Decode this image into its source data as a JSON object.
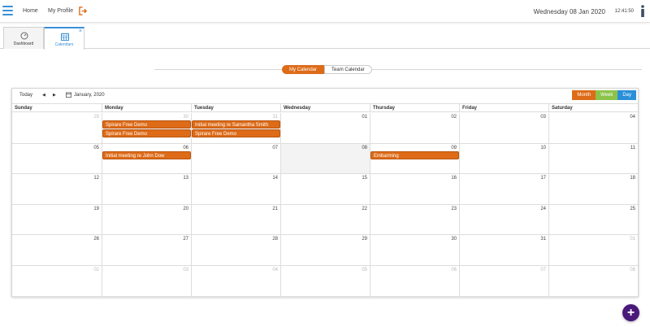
{
  "topbar": {
    "home": "Home",
    "profile": "My Profile",
    "date": "Wednesday 08 Jan 2020",
    "time": "12:41:50"
  },
  "tabs": [
    {
      "label": "Dashboard",
      "icon": "dashboard-icon"
    },
    {
      "label": "Calendars",
      "icon": "calendar-icon",
      "close": "×"
    }
  ],
  "switch": {
    "mine": "My Calendar",
    "team": "Team Calendar"
  },
  "calendar": {
    "today": "Today",
    "prev": "◀",
    "next": "▶",
    "title": "January, 2020",
    "views": [
      "Month",
      "Week",
      "Day"
    ],
    "day_names": [
      "Sunday",
      "Monday",
      "Tuesday",
      "Wednesday",
      "Thursday",
      "Friday",
      "Saturday"
    ],
    "weeks": [
      [
        {
          "n": "29",
          "o": true
        },
        {
          "n": "30",
          "o": true
        },
        {
          "n": "31",
          "o": true
        },
        {
          "n": "01"
        },
        {
          "n": "02"
        },
        {
          "n": "03"
        },
        {
          "n": "04"
        }
      ],
      [
        {
          "n": "05"
        },
        {
          "n": "06"
        },
        {
          "n": "07"
        },
        {
          "n": "08",
          "today": true
        },
        {
          "n": "09"
        },
        {
          "n": "10"
        },
        {
          "n": "11"
        }
      ],
      [
        {
          "n": "12"
        },
        {
          "n": "13"
        },
        {
          "n": "14"
        },
        {
          "n": "15"
        },
        {
          "n": "16"
        },
        {
          "n": "17"
        },
        {
          "n": "18"
        }
      ],
      [
        {
          "n": "19"
        },
        {
          "n": "20"
        },
        {
          "n": "21"
        },
        {
          "n": "22"
        },
        {
          "n": "23"
        },
        {
          "n": "24"
        },
        {
          "n": "25"
        }
      ],
      [
        {
          "n": "26"
        },
        {
          "n": "27"
        },
        {
          "n": "28"
        },
        {
          "n": "29"
        },
        {
          "n": "30"
        },
        {
          "n": "31"
        },
        {
          "n": "01",
          "o": true
        }
      ],
      [
        {
          "n": "02",
          "o": true
        },
        {
          "n": "03",
          "o": true
        },
        {
          "n": "04",
          "o": true
        },
        {
          "n": "05",
          "o": true
        },
        {
          "n": "06",
          "o": true
        },
        {
          "n": "07",
          "o": true
        },
        {
          "n": "08",
          "o": true
        }
      ]
    ],
    "events": [
      {
        "title": "Spirare Free Demo",
        "week": 0,
        "day": 1,
        "slot": 0
      },
      {
        "title": "Spirare Free Demo",
        "week": 0,
        "day": 1,
        "slot": 1
      },
      {
        "title": "Initial meeting re Samantha Smith",
        "week": 0,
        "day": 2,
        "slot": 0
      },
      {
        "title": "Spirare Free Demo",
        "week": 0,
        "day": 2,
        "slot": 1
      },
      {
        "title": "Initial meeting re John Dow",
        "week": 1,
        "day": 1,
        "slot": 0
      },
      {
        "title": "Embarming",
        "week": 1,
        "day": 4,
        "slot": 0
      }
    ]
  },
  "fab": "+",
  "colors": {
    "accent": "#dd6b18",
    "blue": "#2a8fd9",
    "green": "#8bc34a",
    "fab": "#4a1a7a"
  }
}
